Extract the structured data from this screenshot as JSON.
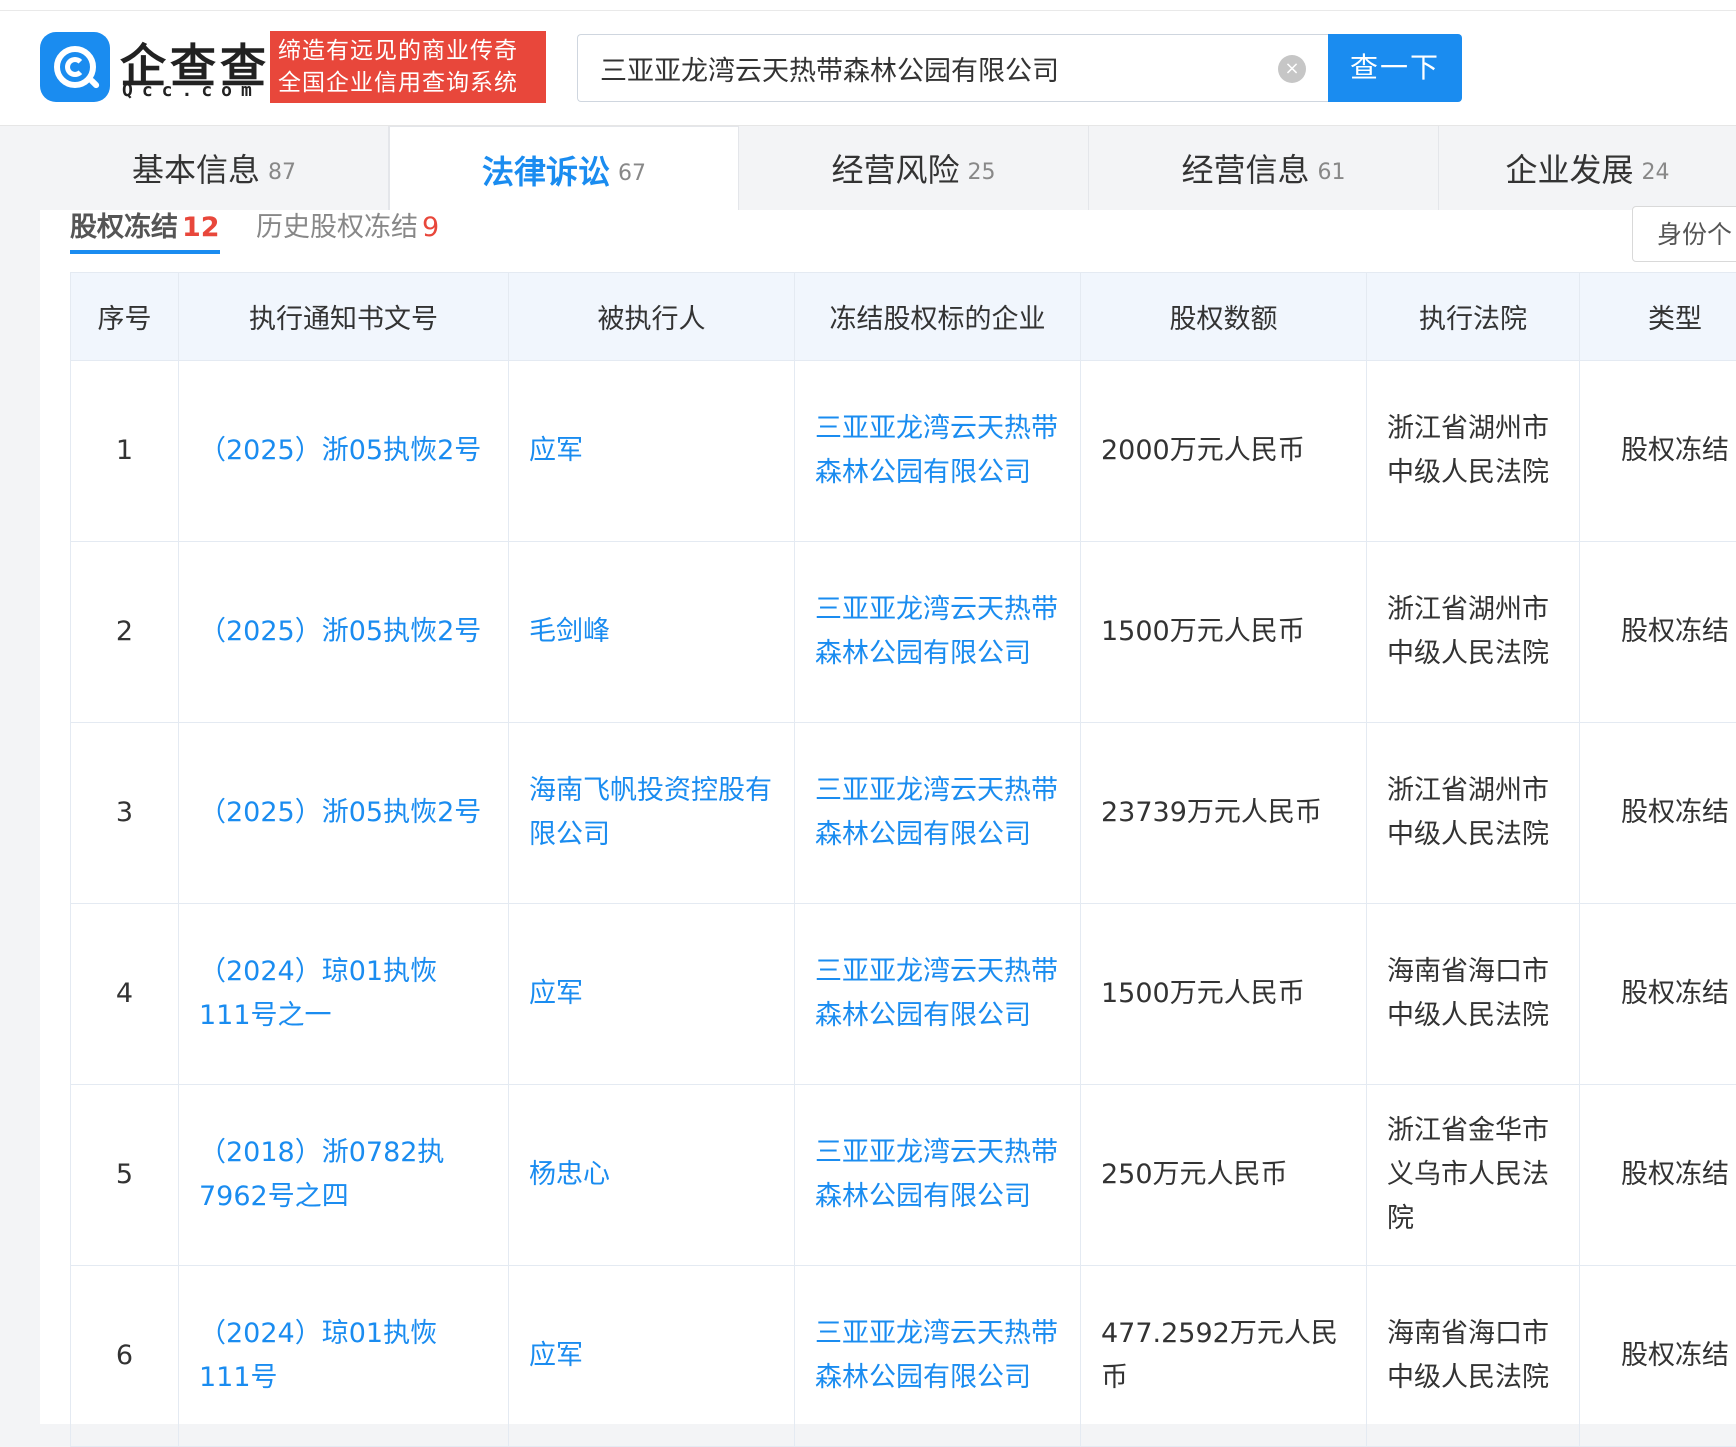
{
  "header": {
    "logo_text": "企查查",
    "logo_sub": "Qcc.com",
    "slogan_line1": "缔造有远见的商业传奇",
    "slogan_line2": "全国企业信用查询系统",
    "search_value": "三亚亚龙湾云天热带森林公园有限公司",
    "clear_icon": "×",
    "search_button": "查一下"
  },
  "tabs": [
    {
      "label": "基本信息",
      "count": "87"
    },
    {
      "label": "法律诉讼",
      "count": "67"
    },
    {
      "label": "经营风险",
      "count": "25"
    },
    {
      "label": "经营信息",
      "count": "61"
    },
    {
      "label": "企业发展",
      "count": "24"
    }
  ],
  "subtabs": [
    {
      "label": "股权冻结",
      "count": "12"
    },
    {
      "label": "历史股权冻结",
      "count": "9"
    }
  ],
  "id_filter": "身份个",
  "table": {
    "headers": [
      "序号",
      "执行通知书文号",
      "被执行人",
      "冻结股权标的企业",
      "股权数额",
      "执行法院",
      "类型"
    ],
    "rows": [
      {
        "no": "1",
        "doc": "（2025）浙05执恢2号",
        "person": "应军",
        "company": "三亚亚龙湾云天热带森林公园有限公司",
        "amount": "2000万元人民币",
        "court": "浙江省湖州市中级人民法院",
        "type": "股权冻结"
      },
      {
        "no": "2",
        "doc": "（2025）浙05执恢2号",
        "person": "毛剑峰",
        "company": "三亚亚龙湾云天热带森林公园有限公司",
        "amount": "1500万元人民币",
        "court": "浙江省湖州市中级人民法院",
        "type": "股权冻结"
      },
      {
        "no": "3",
        "doc": "（2025）浙05执恢2号",
        "person": "海南飞帆投资控股有限公司",
        "company": "三亚亚龙湾云天热带森林公园有限公司",
        "amount": "23739万元人民币",
        "court": "浙江省湖州市中级人民法院",
        "type": "股权冻结"
      },
      {
        "no": "4",
        "doc": "（2024）琼01执恢111号之一",
        "person": "应军",
        "company": "三亚亚龙湾云天热带森林公园有限公司",
        "amount": "1500万元人民币",
        "court": "海南省海口市中级人民法院",
        "type": "股权冻结"
      },
      {
        "no": "5",
        "doc": "（2018）浙0782执7962号之四",
        "person": "杨忠心",
        "company": "三亚亚龙湾云天热带森林公园有限公司",
        "amount": "250万元人民币",
        "court": "浙江省金华市义乌市人民法院",
        "type": "股权冻结"
      },
      {
        "no": "6",
        "doc": "（2024）琼01执恢111号",
        "person": "应军",
        "company": "三亚亚龙湾云天热带森林公园有限公司",
        "amount": "477.2592万元人民币",
        "court": "海南省海口市中级人民法院",
        "type": "股权冻结"
      }
    ]
  }
}
